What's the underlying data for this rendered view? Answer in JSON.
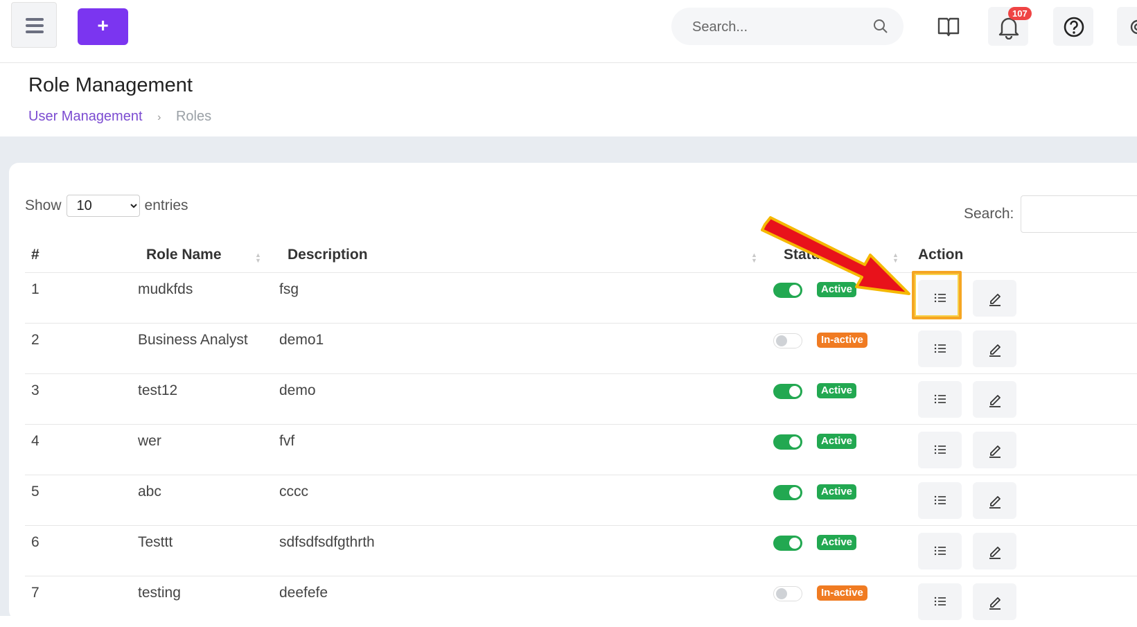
{
  "topbar": {
    "add_label": "+",
    "search_placeholder": "Search...",
    "notification_count": "107",
    "icons": [
      "menu-icon",
      "book-icon",
      "bell-icon",
      "help-icon",
      "gear-icon"
    ]
  },
  "header": {
    "title": "Role Management",
    "breadcrumb": {
      "parent": "User Management",
      "separator": "›",
      "current": "Roles"
    }
  },
  "controls": {
    "show_label": "Show",
    "entries_value": "10",
    "entries_label": "entries",
    "search_label": "Search:"
  },
  "table": {
    "columns": {
      "num": "#",
      "role_name": "Role Name",
      "description": "Description",
      "status": "Status",
      "action": "Action"
    },
    "rows": [
      {
        "num": "1",
        "role_name": "mudkfds",
        "description": "fsg",
        "status": "Active",
        "enabled": true
      },
      {
        "num": "2",
        "role_name": "Business Analyst",
        "description": "demo1",
        "status": "In-active",
        "enabled": false
      },
      {
        "num": "3",
        "role_name": "test12",
        "description": "demo",
        "status": "Active",
        "enabled": true
      },
      {
        "num": "4",
        "role_name": "wer",
        "description": "fvf",
        "status": "Active",
        "enabled": true
      },
      {
        "num": "5",
        "role_name": "abc",
        "description": "cccc",
        "status": "Active",
        "enabled": true
      },
      {
        "num": "6",
        "role_name": "Testtt",
        "description": "sdfsdfsdfgthrth",
        "status": "Active",
        "enabled": true
      },
      {
        "num": "7",
        "role_name": "testing",
        "description": "deefefe",
        "status": "In-active",
        "enabled": false
      }
    ]
  },
  "colors": {
    "accent": "#7b35f0",
    "active": "#22a851",
    "inactive": "#f07b22",
    "highlight": "#f5a623",
    "arrow": "#e8121b"
  }
}
